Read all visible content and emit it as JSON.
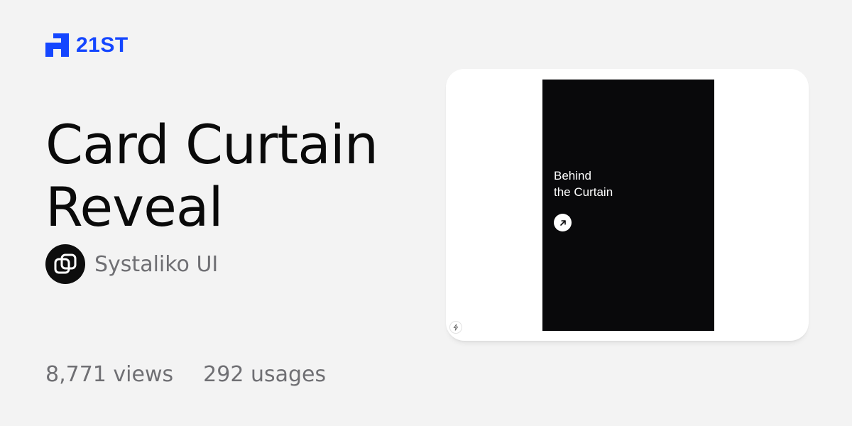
{
  "brand": {
    "name": "21ST",
    "logo_icon": "21st-logo-icon",
    "color": "#1446ff"
  },
  "component": {
    "title_line1": "Card Curtain",
    "title_line2": "Reveal"
  },
  "author": {
    "name": "Systaliko UI",
    "avatar_icon": "linked-squares-icon"
  },
  "stats": {
    "views": "8,771 views",
    "usages": "292 usages"
  },
  "preview": {
    "heading_line1": "Behind",
    "heading_line2": "the Curtain",
    "button_icon": "arrow-up-right-icon",
    "badge_icon": "bolt-icon",
    "card_color": "#09090b"
  }
}
